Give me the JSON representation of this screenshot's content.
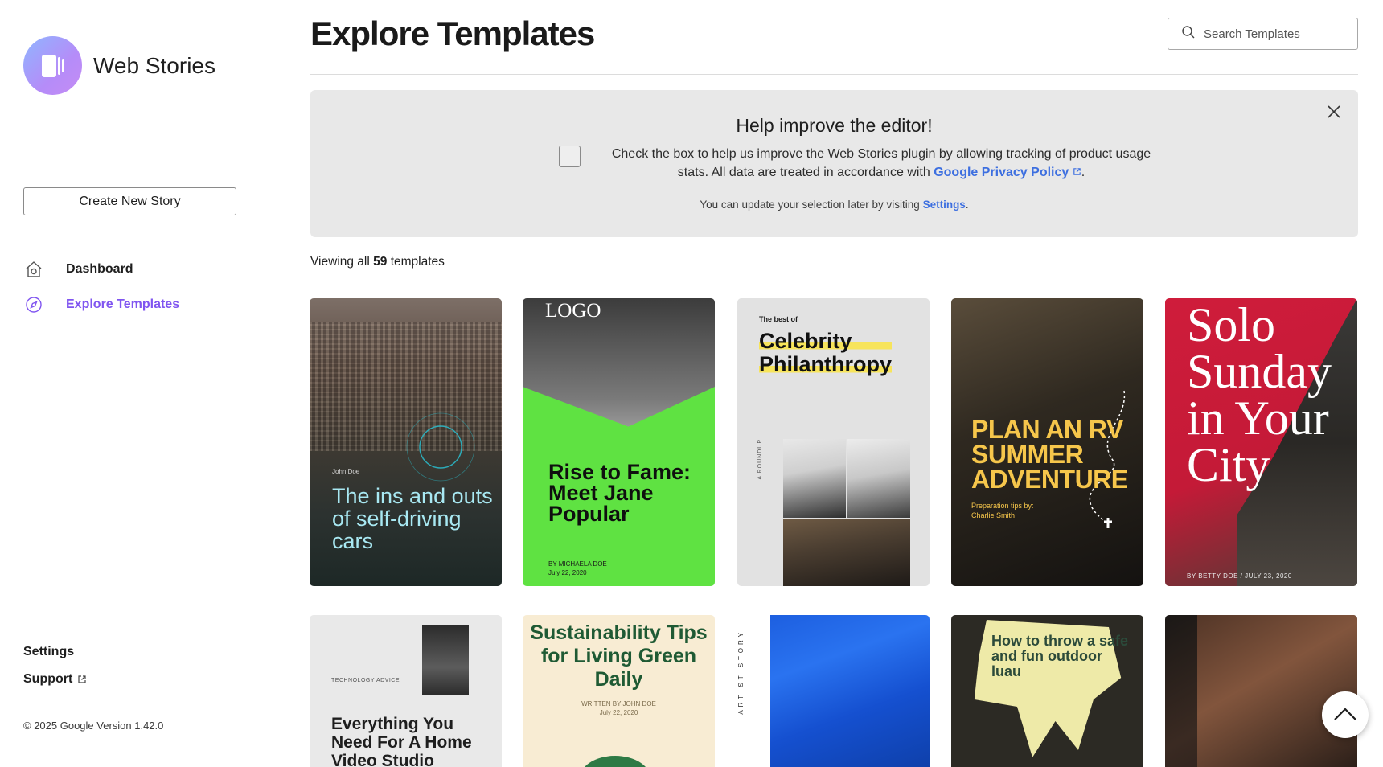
{
  "brand": {
    "title": "Web Stories",
    "logo_colors": [
      "#8fb6ff",
      "#b58cf8"
    ]
  },
  "sidebar": {
    "create_button": "Create New Story",
    "nav": [
      {
        "label": "Dashboard",
        "icon": "home-icon",
        "active": false
      },
      {
        "label": "Explore Templates",
        "icon": "compass-icon",
        "active": true
      }
    ],
    "settings_label": "Settings",
    "support_label": "Support",
    "footer": "© 2025 Google Version 1.42.0"
  },
  "header": {
    "title": "Explore Templates",
    "search_placeholder": "Search Templates"
  },
  "banner": {
    "title": "Help improve the editor!",
    "text_before_link": "Check the box to help us improve the Web Stories plugin by allowing tracking of product usage stats. All data are treated in accordance with ",
    "link_label": "Google Privacy Policy",
    "text_after_link": ".",
    "sub_before_link": "You can update your selection later by visiting ",
    "sub_link_label": "Settings",
    "sub_after_link": ".",
    "checked": false
  },
  "viewing": {
    "prefix": "Viewing all",
    "count": "59",
    "suffix": "templates"
  },
  "templates": [
    {
      "author": "John Doe",
      "headline": "The ins and outs of self-driving cars"
    },
    {
      "logo": "LOGO",
      "headline": "Rise to Fame: Meet Jane Popular",
      "byline": "BY MICHAELA DOE",
      "date": "July 22, 2020"
    },
    {
      "kicker": "The best of",
      "headline_line1": "Celebrity",
      "headline_line2": "Philanthropy",
      "side_label": "A ROUNDUP"
    },
    {
      "headline": "PLAN AN RV SUMMER ADVENTURE",
      "sub1": "Preparation tips by:",
      "sub2": "Charlie Smith"
    },
    {
      "headline": "Solo Sunday in Your City",
      "byline": "BY BETTY DOE / JULY 23, 2020"
    },
    {
      "kicker": "TECHNOLOGY ADVICE",
      "headline": "Everything You Need For A Home Video Studio"
    },
    {
      "headline": "Sustainability Tips for Living Green Daily",
      "byline": "WRITTEN BY JOHN DOE",
      "date": "July 22, 2020"
    },
    {
      "side_label": "ARTIST STORY"
    },
    {
      "headline": "How to throw a safe and fun outdoor luau"
    },
    {}
  ],
  "accent_color": "#8055f0",
  "link_color": "#3d6fe0"
}
